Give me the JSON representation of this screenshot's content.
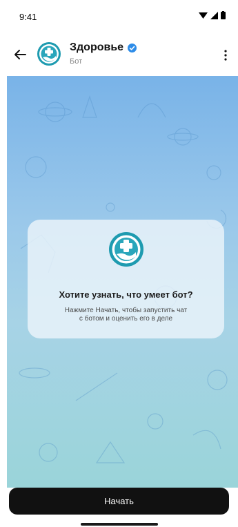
{
  "status": {
    "time": "9:41"
  },
  "header": {
    "title": "Здоровье",
    "subtitle": "Бот"
  },
  "card": {
    "title": "Хотите узнать, что умеет бот?",
    "text_line1": "Нажмите Начать, чтобы запустить чат",
    "text_line2": "с ботом и оценить его в деле"
  },
  "actions": {
    "start_label": "Начать"
  },
  "icons": {
    "back": "arrow-left-icon",
    "verified": "verified-badge-icon",
    "menu": "more-vertical-icon",
    "logo": "health-cross-hand-icon"
  },
  "colors": {
    "accent": "#1e9bb0",
    "verified": "#2d8ce8",
    "button": "#111111"
  }
}
